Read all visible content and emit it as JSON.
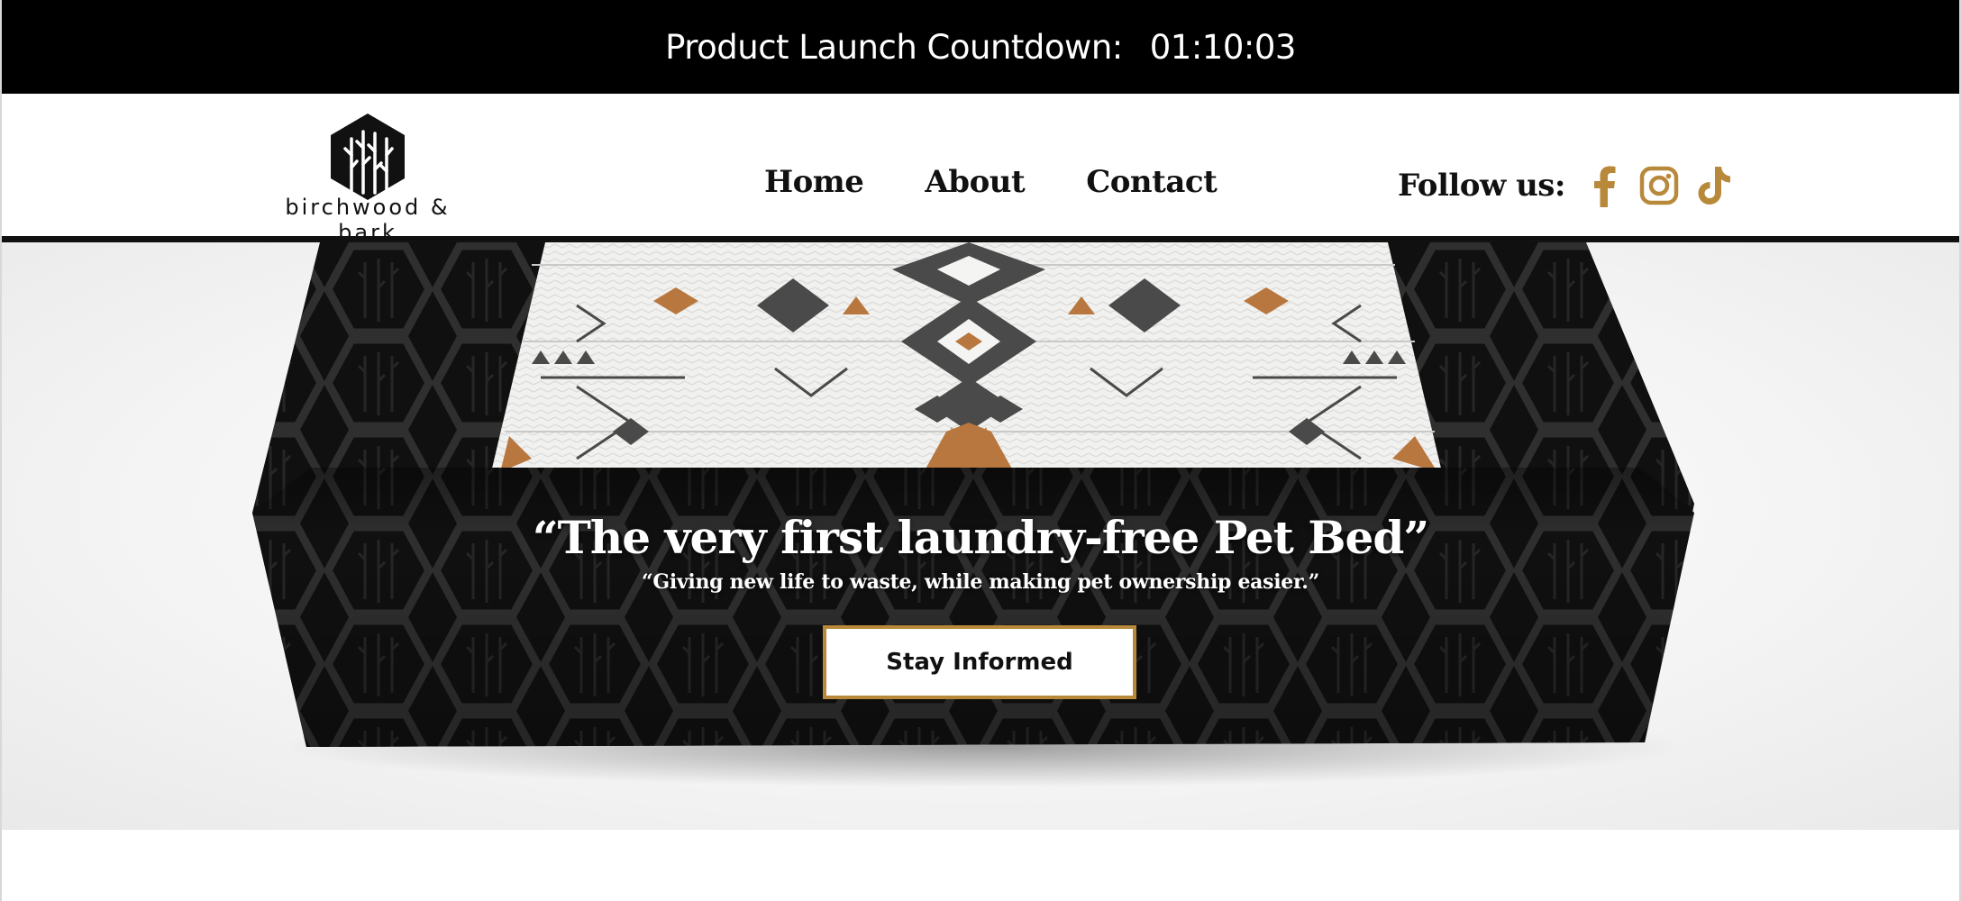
{
  "countdown": {
    "label": "Product Launch Countdown:",
    "time": "01:10:03"
  },
  "brand": {
    "name": "birchwood & bark"
  },
  "nav": {
    "items": [
      {
        "label": "Home"
      },
      {
        "label": "About"
      },
      {
        "label": "Contact"
      }
    ]
  },
  "social": {
    "label": "Follow us:",
    "icons": [
      "facebook-icon",
      "instagram-icon",
      "tiktok-icon"
    ]
  },
  "hero": {
    "title": "“The very first laundry-free Pet Bed”",
    "subtitle": "“Giving new life to waste, while making pet ownership easier.”",
    "cta_label": "Stay Informed"
  },
  "colors": {
    "accent": "#B8893A",
    "dark": "#111111",
    "banner": "#000000",
    "rust": "#B8773E"
  }
}
